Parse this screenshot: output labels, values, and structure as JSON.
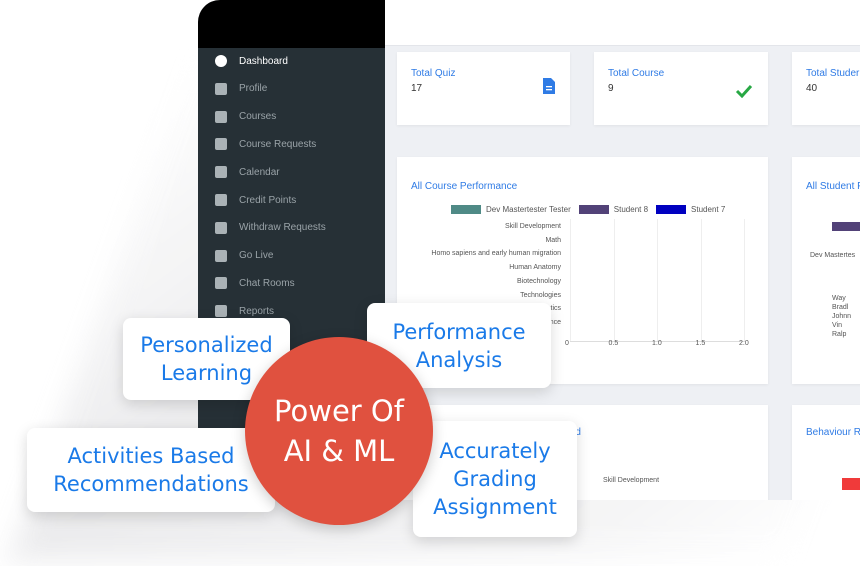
{
  "sidebar": {
    "items": [
      {
        "label": "Dashboard",
        "icon": "dashboard-icon",
        "active": true
      },
      {
        "label": "Profile",
        "icon": "user-icon"
      },
      {
        "label": "Courses",
        "icon": "laptop-icon"
      },
      {
        "label": "Course Requests",
        "icon": "envelope-icon"
      },
      {
        "label": "Calendar",
        "icon": "calendar-icon"
      },
      {
        "label": "Credit Points",
        "icon": "credit-icon"
      },
      {
        "label": "Withdraw Requests",
        "icon": "withdraw-icon"
      },
      {
        "label": "Go Live",
        "icon": "handshake-icon"
      },
      {
        "label": "Chat Rooms",
        "icon": "chat-icon"
      },
      {
        "label": "Reports",
        "icon": "reports-icon"
      }
    ]
  },
  "stats": [
    {
      "title": "Total Quiz",
      "value": "17",
      "icon": "document-icon",
      "color": "#2f7be5"
    },
    {
      "title": "Total Course",
      "value": "9",
      "icon": "check-icon",
      "color": "#27a844"
    },
    {
      "title": "Total Studer",
      "value": "40"
    }
  ],
  "chart_data": {
    "type": "bar",
    "orientation": "horizontal",
    "title": "All Course Performance",
    "legend": [
      "Dev Mastertester Tester",
      "Student 8",
      "Student 7"
    ],
    "legend_colors": [
      "#4f8a86",
      "#524278",
      "#0000c0"
    ],
    "categories": [
      "Skill Development",
      "Math",
      "Homo sapiens and early human migration",
      "Human Anatomy",
      "Biotechnology",
      "Technologies",
      "tics",
      "nce"
    ],
    "xticks": [
      "0",
      "0.5",
      "1.0",
      "1.5",
      "2.0"
    ],
    "xlim": [
      0,
      2
    ],
    "grid": true
  },
  "right_chart": {
    "title": "All Student P",
    "legend_color": "#524278",
    "labels": [
      "Dev Mastertes",
      "Way",
      "Bradl",
      "Johnn",
      "Vin",
      "Ralp"
    ]
  },
  "bottom": {
    "left_title": "ted",
    "left_label": "Skill Development",
    "right_title": "Behaviour R",
    "right_bar_color": "#f03a3a"
  },
  "features": {
    "center": "Power Of AI & ML",
    "personalized": "Personalized Learning",
    "performance": "Performance Analysis",
    "activities": "Activities Based Recommendations",
    "grading": "Accurately Grading Assignment"
  },
  "colors": {
    "accent": "#1a7ae8",
    "circle": "#e0513f",
    "sidebar": "#263036"
  }
}
